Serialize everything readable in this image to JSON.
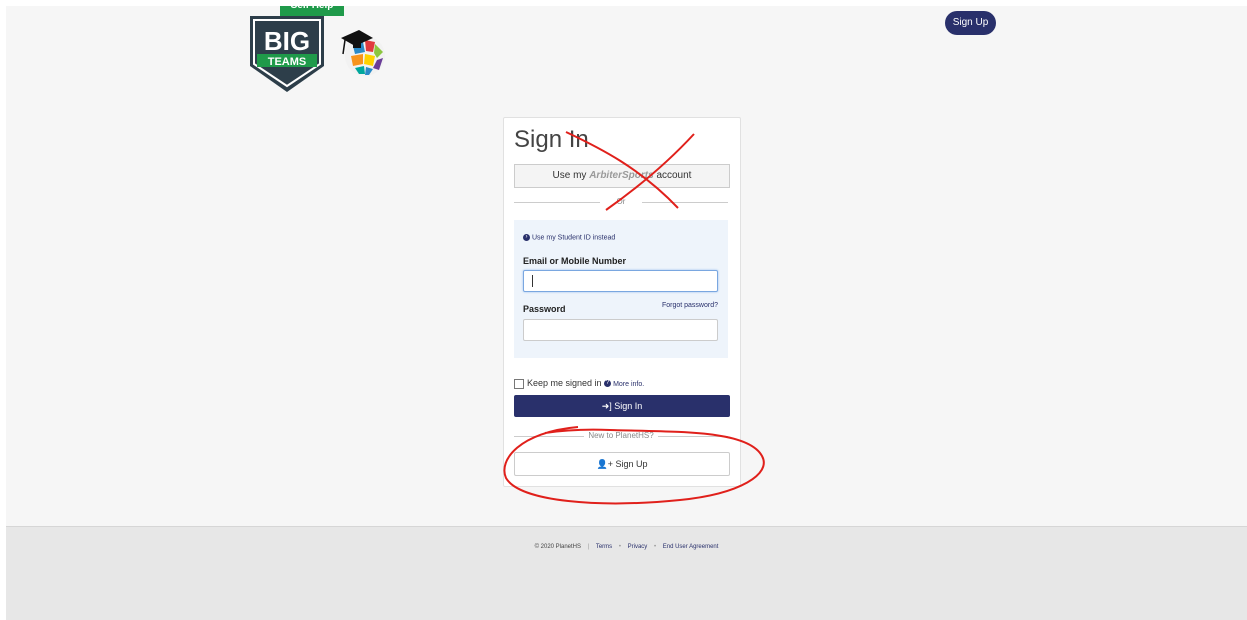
{
  "header": {
    "self_help": "Self Help",
    "logo_big": "BIG",
    "logo_teams": "TEAMS",
    "signup_label": "Sign Up"
  },
  "card": {
    "title": "Sign In",
    "arbiter_prefix": "Use my",
    "arbiter_brand": "ArbiterSports",
    "arbiter_suffix": "account",
    "or_label": "Or",
    "student_id_link": "Use my Student ID instead",
    "email_label": "Email or Mobile Number",
    "email_value": "",
    "password_label": "Password",
    "password_value": "",
    "forgot_password": "Forgot password?",
    "keep_signed_in": "Keep me signed in",
    "more_info": "More info.",
    "sign_in_label": "Sign In",
    "new_to_label": "New to PlanetHS?",
    "sign_up_label": "Sign Up"
  },
  "footer": {
    "copyright": "© 2020 PlanetHS",
    "links": [
      "Terms",
      "Privacy",
      "End User Agreement"
    ]
  },
  "colors": {
    "brand_navy": "#29306b",
    "self_help_green": "#1f9a4a",
    "annotation_red": "#e0201b"
  }
}
